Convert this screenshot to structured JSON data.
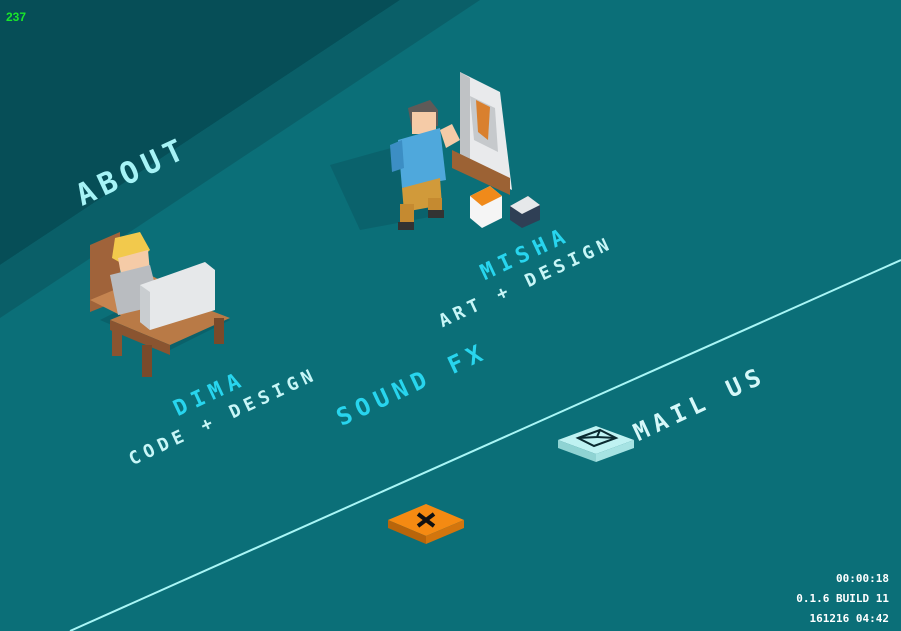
{
  "hud": {
    "fps": "237"
  },
  "screen": {
    "title": "ABOUT"
  },
  "credits": {
    "dima": {
      "name": "DIMA",
      "role": "CODE + DESIGN"
    },
    "misha": {
      "name": "MISHA",
      "role": "ART + DESIGN"
    },
    "sound": {
      "label": "SOUND FX"
    }
  },
  "actions": {
    "mail": {
      "label": "MAIL US",
      "icon": "envelope-icon"
    },
    "close": {
      "icon": "close-x-icon"
    }
  },
  "info": {
    "timer": "00:00:18",
    "version": "0.1.6 BUILD 11",
    "date": "161216 04:42"
  },
  "colors": {
    "background": "#0b6f78",
    "banner": "#06505a",
    "name": "#28d5ee",
    "close": "#f58a12",
    "mail": "#bff2f2"
  }
}
